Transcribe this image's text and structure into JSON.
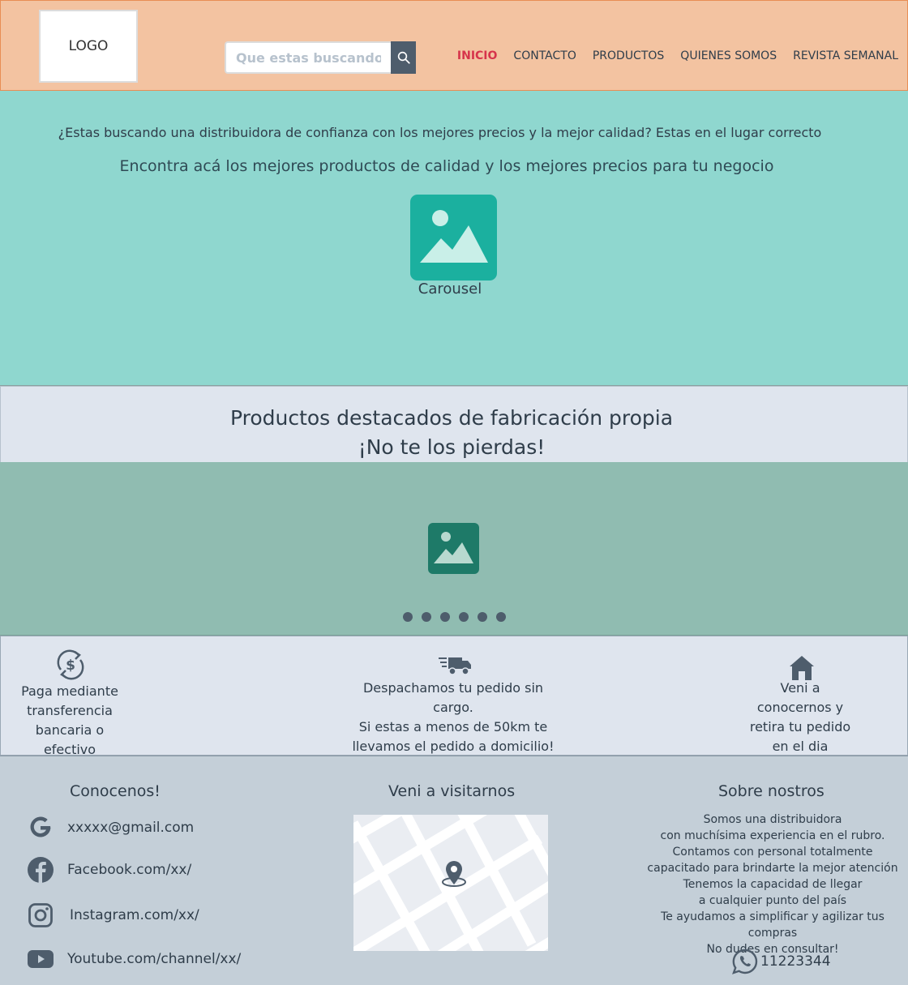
{
  "header": {
    "logo_text": "LOGO",
    "search": {
      "placeholder": "Que estas buscando?..."
    },
    "nav": [
      {
        "label": "INICIO"
      },
      {
        "label": "CONTACTO"
      },
      {
        "label": "PRODUCTOS"
      },
      {
        "label": "QUIENES SOMOS"
      },
      {
        "label": "REVISTA SEMANAL"
      }
    ]
  },
  "hero": {
    "intro": "¿Estas buscando una distribuidora de confianza con los mejores precios y la mejor calidad? Estas en el lugar correcto",
    "tagline": "Encontra acá los mejores productos de calidad y los mejores precios para tu negocio",
    "carousel_caption": "Carousel"
  },
  "featured": {
    "title": "Productos destacados de fabricación propia",
    "subtitle": "¡No te los pierdas!"
  },
  "slider": {
    "dot_count": 6
  },
  "info": {
    "payment": [
      "Paga mediante",
      "transferencia",
      "bancaria o",
      "efectivo"
    ],
    "shipping": [
      "Despachamos tu pedido sin",
      "cargo.",
      "Si estas a menos de 50km te",
      "llevamos el pedido a domicilio!"
    ],
    "pickup": [
      "Veni a",
      "conocernos y",
      "retira tu pedido",
      "en el dia"
    ]
  },
  "footer": {
    "contact_title": "Conocenos!",
    "social": {
      "gmail": "xxxxx@gmail.com",
      "facebook": "Facebook.com/xx/",
      "instagram": "Instagram.com/xx/",
      "youtube": "Youtube.com/channel/xx/"
    },
    "visit_title": "Veni a visitarnos",
    "about_title": "Sobre nostros",
    "about_lines": [
      "Somos una distribuidora",
      "con muchísima experiencia en el rubro.",
      "Contamos con personal totalmente",
      "capacitado para brindarte la mejor atención",
      "Tenemos la capacidad de llegar",
      "a cualquier punto del país",
      "Te ayudamos a simplificar y agilizar tus compras",
      "No dudes en consultar!"
    ],
    "phone": "11223344"
  },
  "colors": {
    "header_bg": "#f3c3a1",
    "hero_bg": "#8fd7cf",
    "slider_bg": "#90bcb1",
    "light_bg": "#dfe5ee",
    "footer_bg": "#c4cfd8",
    "active_nav": "#d6344b",
    "dark": "#4e5d6c"
  },
  "icons": [
    "search-icon",
    "image-icon",
    "money-exchange-icon",
    "delivery-truck-icon",
    "home-icon",
    "google-icon",
    "facebook-icon",
    "instagram-icon",
    "youtube-icon",
    "map-pin-icon",
    "whatsapp-icon"
  ]
}
